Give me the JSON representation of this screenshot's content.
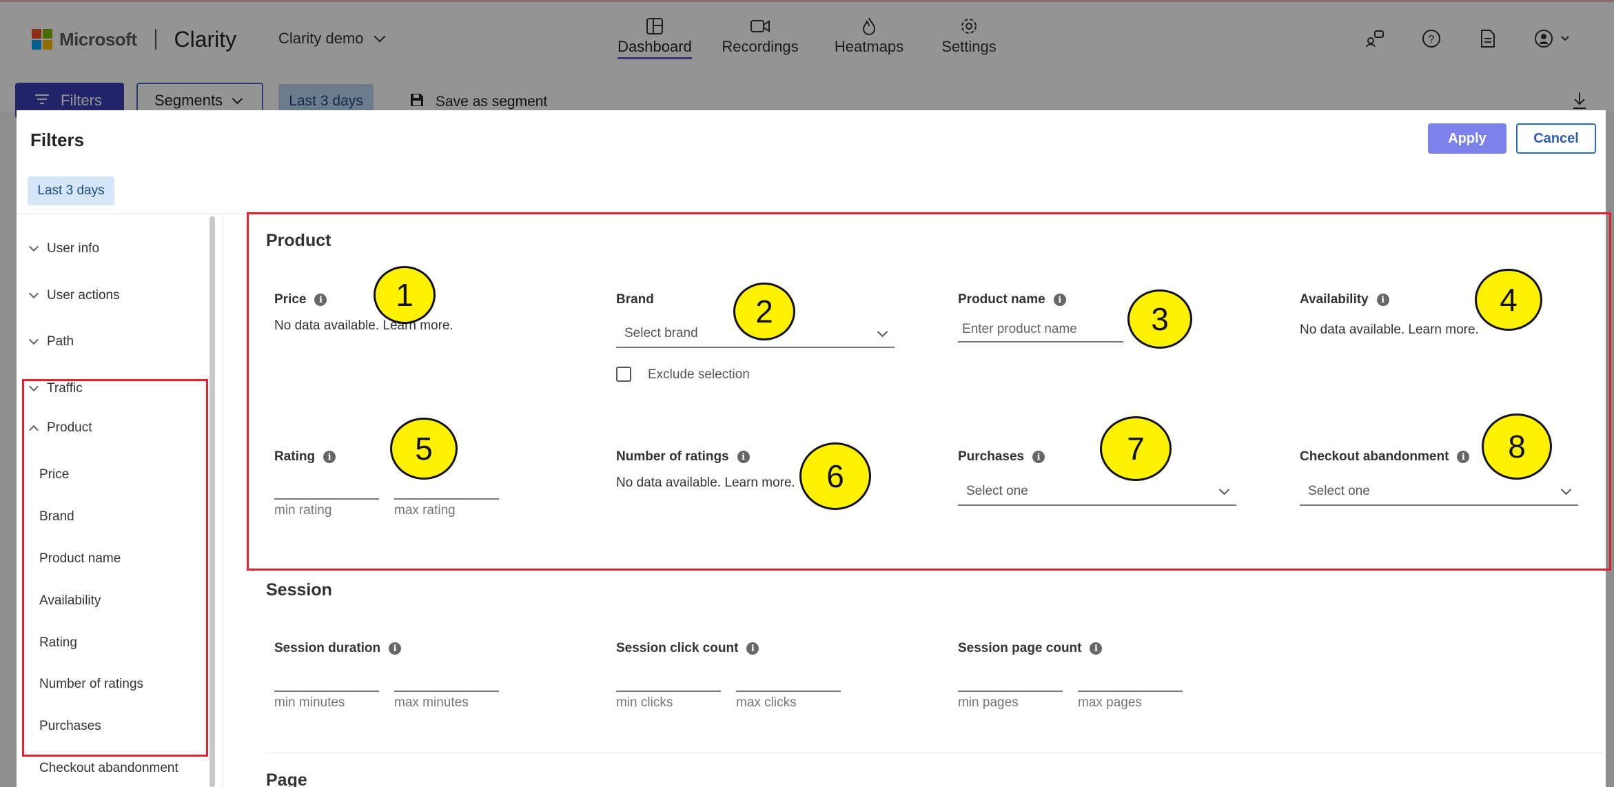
{
  "topbar": {
    "company": "Microsoft",
    "product": "Clarity",
    "project": "Clarity demo",
    "tabs": [
      {
        "label": "Dashboard",
        "icon": "dashboard-icon"
      },
      {
        "label": "Recordings",
        "icon": "video-icon"
      },
      {
        "label": "Heatmaps",
        "icon": "flame-icon"
      },
      {
        "label": "Settings",
        "icon": "gear-icon"
      }
    ],
    "right_icons": [
      "share-users-icon",
      "help-icon",
      "document-icon",
      "account-icon"
    ]
  },
  "toolbar": {
    "filters_label": "Filters",
    "segments_label": "Segments",
    "date_chip": "Last 3 days",
    "save_segment_label": "Save as segment"
  },
  "panel": {
    "title": "Filters",
    "apply_label": "Apply",
    "cancel_label": "Cancel",
    "date_chip": "Last 3 days",
    "accent": "#7b83eb"
  },
  "sidebar": {
    "groups": [
      "User info",
      "User actions",
      "Path",
      "Traffic"
    ],
    "expanded_group": "Product",
    "items": [
      "Price",
      "Brand",
      "Product name",
      "Availability",
      "Rating",
      "Number of ratings",
      "Purchases",
      "Checkout abandonment"
    ]
  },
  "product": {
    "title": "Product",
    "price": {
      "label": "Price",
      "text": "No data available. Learn more."
    },
    "brand": {
      "label": "Brand",
      "placeholder": "Select brand",
      "exclude_label": "Exclude selection"
    },
    "product_name": {
      "label": "Product name",
      "placeholder": "Enter product name"
    },
    "availability": {
      "label": "Availability",
      "text": "No data available. Learn more."
    },
    "rating": {
      "label": "Rating",
      "min": "min rating",
      "max": "max rating"
    },
    "num_ratings": {
      "label": "Number of ratings",
      "text": "No data available. Learn more."
    },
    "purchases": {
      "label": "Purchases",
      "placeholder": "Select one"
    },
    "checkout": {
      "label": "Checkout abandonment",
      "placeholder": "Select one"
    }
  },
  "session": {
    "title": "Session",
    "duration": {
      "label": "Session duration",
      "min": "min minutes",
      "max": "max minutes"
    },
    "clicks": {
      "label": "Session click count",
      "min": "min clicks",
      "max": "max clicks"
    },
    "pages": {
      "label": "Session page count",
      "min": "min pages",
      "max": "max pages"
    }
  },
  "page_section": {
    "title": "Page"
  },
  "annotations": [
    "1",
    "2",
    "3",
    "4",
    "5",
    "6",
    "7",
    "8"
  ],
  "colors": {
    "annotation_box": "#e0232d",
    "annotation_circle": "#fff200"
  }
}
